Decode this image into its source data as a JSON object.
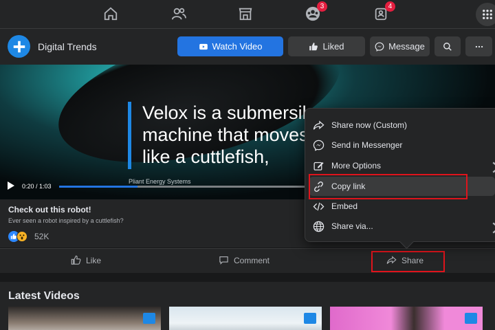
{
  "topnav": {
    "icons": [
      "home-icon",
      "friends-icon",
      "marketplace-icon",
      "groups-icon",
      "pages-icon",
      "menu-grid-icon"
    ],
    "groups_badge": "3",
    "pages_badge": "4"
  },
  "page_header": {
    "name": "Digital Trends",
    "watch_label": "Watch Video",
    "liked_label": "Liked",
    "message_label": "Message"
  },
  "video": {
    "overlay_text": "Velox is a submersible\nmachine that moves\nlike a cuttlefish,",
    "credit": "Pliant Energy Systems",
    "time": "0:20 / 1:03",
    "progress": 0.317
  },
  "post": {
    "title": "Check out this robot!",
    "subtitle": "Ever seen a robot inspired by a cuttlefish?",
    "reaction_count": "52K"
  },
  "actions": {
    "like_label": "Like",
    "comment_label": "Comment",
    "share_label": "Share"
  },
  "share_menu": {
    "items": [
      {
        "label": "Share now (Custom)",
        "icon": "share-arrow-icon"
      },
      {
        "label": "Send in Messenger",
        "icon": "messenger-icon"
      },
      {
        "label": "More Options",
        "icon": "edit-icon"
      },
      {
        "label": "Copy link",
        "icon": "link-icon"
      },
      {
        "label": "Embed",
        "icon": "code-icon"
      },
      {
        "label": "Share via...",
        "icon": "globe-icon"
      }
    ]
  },
  "latest": {
    "title": "Latest Videos"
  },
  "colors": {
    "accent": "#2374e1",
    "highlight_box": "#e0141c",
    "background": "#18191a",
    "surface": "#242526"
  }
}
